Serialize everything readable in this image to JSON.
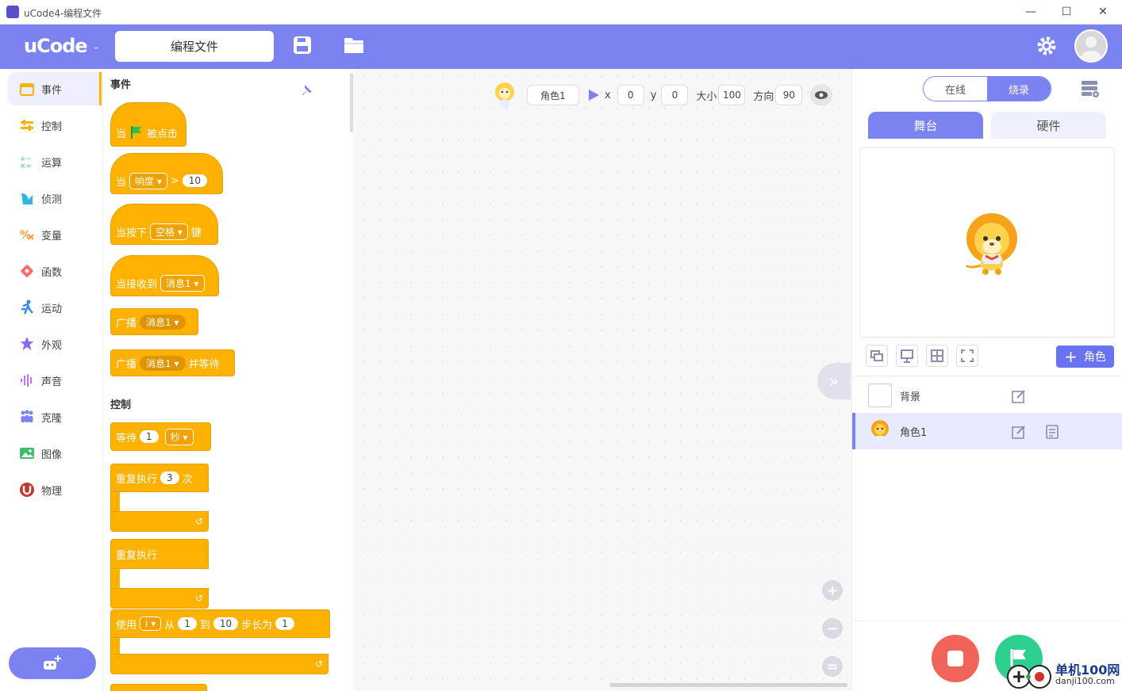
{
  "window": {
    "title": "uCode4-编程文件",
    "minimize": "—",
    "maximize": "☐",
    "close": "✕"
  },
  "topbar": {
    "brand": "uCode",
    "brand_caret": "⌄",
    "file_name": "编程文件"
  },
  "sidebar": {
    "items": [
      {
        "label": "事件",
        "icon": "event-icon",
        "color": "#ffb100"
      },
      {
        "label": "控制",
        "icon": "control-icon",
        "color": "#ffb100"
      },
      {
        "label": "运算",
        "icon": "operator-icon",
        "color": "#3ecc9a"
      },
      {
        "label": "侦测",
        "icon": "sensing-icon",
        "color": "#2fb6e8"
      },
      {
        "label": "变量",
        "icon": "variable-icon",
        "color": "#ff9a3c"
      },
      {
        "label": "函数",
        "icon": "function-icon",
        "color": "#ff6a6a"
      },
      {
        "label": "运动",
        "icon": "motion-icon",
        "color": "#2f8ae8"
      },
      {
        "label": "外观",
        "icon": "looks-icon",
        "color": "#8a6cf0"
      },
      {
        "label": "声音",
        "icon": "sound-icon",
        "color": "#c56cf0"
      },
      {
        "label": "克隆",
        "icon": "clone-icon",
        "color": "#7b83f2"
      },
      {
        "label": "图像",
        "icon": "image-icon",
        "color": "#3ec06a"
      },
      {
        "label": "物理",
        "icon": "physics-icon",
        "color": "#c0392b"
      }
    ]
  },
  "palette": {
    "sec_events": "事件",
    "sec_control": "控制",
    "b1": {
      "w1": "当",
      "w2": "被点击"
    },
    "b2": {
      "w1": "当",
      "dd": "响度",
      "op": ">",
      "v": "10"
    },
    "b3": {
      "w1": "当按下",
      "dd": "空格",
      "w2": "键"
    },
    "b4": {
      "w1": "当接收到",
      "dd": "消息1"
    },
    "b5": {
      "w1": "广播",
      "dd": "消息1"
    },
    "b6": {
      "w1": "广播",
      "dd": "消息1",
      "w2": "并等待"
    },
    "c1": {
      "w1": "等待",
      "v": "1",
      "dd": "秒"
    },
    "c2": {
      "w1": "重复执行",
      "v": "3",
      "w2": "次"
    },
    "c3": {
      "w1": "重复执行"
    },
    "c4": {
      "w1": "使用",
      "dd": "i",
      "w2": "从",
      "v1": "1",
      "w3": "到",
      "v2": "10",
      "w4": "步长为",
      "v3": "1"
    },
    "caret": "▾",
    "loop_arrow": "↺"
  },
  "sprite_bar": {
    "name": "角色1",
    "x_label": "x",
    "x": "0",
    "y_label": "y",
    "y": "0",
    "size_label": "大小",
    "size": "100",
    "dir_label": "方向",
    "dir": "90"
  },
  "workspace": {
    "collapse": "»",
    "zoom_in": "+",
    "zoom_out": "−",
    "zoom_reset": "="
  },
  "right": {
    "mode_online": "在线",
    "mode_burn": "烧录",
    "tab_stage": "舞台",
    "tab_hardware": "硬件",
    "add_role": "角色",
    "add_plus": "+",
    "rows": [
      {
        "label": "背景"
      },
      {
        "label": "角色1"
      }
    ]
  },
  "watermark": {
    "line1": "单机100网",
    "line2": "danji100.com"
  }
}
